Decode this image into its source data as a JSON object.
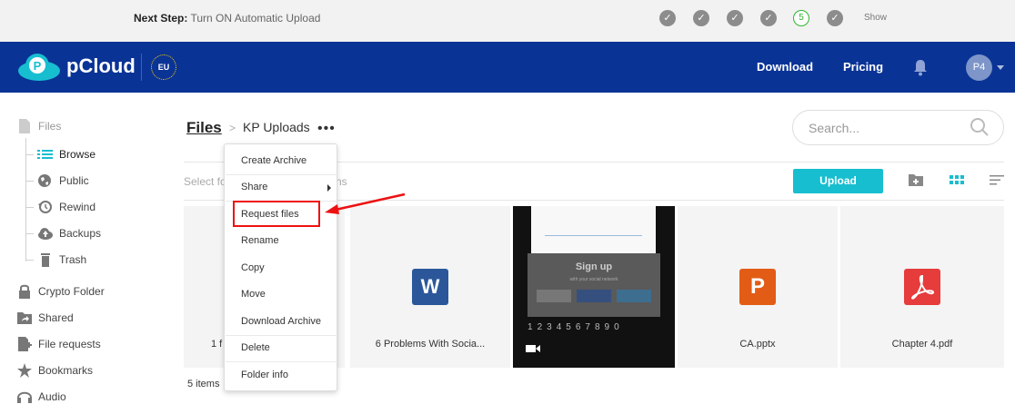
{
  "topbar": {
    "next_step_label": "Next Step:",
    "next_step_text": "Turn ON Automatic Upload",
    "current_step": "5",
    "show_label": "Show"
  },
  "header": {
    "brand": "pCloud",
    "region": "EU",
    "nav_download": "Download",
    "nav_pricing": "Pricing",
    "avatar_initials": "P4"
  },
  "sidebar": {
    "files": "Files",
    "browse": "Browse",
    "public": "Public",
    "rewind": "Rewind",
    "backups": "Backups",
    "trash": "Trash",
    "crypto": "Crypto Folder",
    "shared": "Shared",
    "file_requests": "File requests",
    "bookmarks": "Bookmarks",
    "audio": "Audio"
  },
  "breadcrumb": {
    "root": "Files",
    "separator": ">",
    "current": "KP Uploads",
    "more": "•••"
  },
  "search": {
    "placeholder": "Search..."
  },
  "toolbar": {
    "select_prefix": "Select fo",
    "select_suffix": "ns",
    "upload_label": "Upload"
  },
  "files": [
    {
      "name": "1 f",
      "type": "folder"
    },
    {
      "name": "6 Problems With Socia...",
      "type": "docx",
      "icon_letter": "W",
      "icon_color": "#2b579a"
    },
    {
      "name": "",
      "type": "video"
    },
    {
      "name": "CA.pptx",
      "type": "pptx",
      "icon_letter": "P",
      "icon_color": "#e35c16"
    },
    {
      "name": "Chapter 4.pdf",
      "type": "pdf",
      "icon_color": "#e63c3c"
    }
  ],
  "video_thumb": {
    "title": "Sign up",
    "subtitle": "with your social network",
    "key_row": [
      "1",
      "2",
      "3",
      "4",
      "5",
      "6",
      "7",
      "8",
      "9",
      "0"
    ]
  },
  "item_count": "5 items",
  "context_menu": [
    "Create Archive",
    "Share",
    "Request files",
    "Rename",
    "Copy",
    "Move",
    "Download Archive",
    "Delete",
    "Folder info"
  ],
  "colors": {
    "header_bg": "#0a3396",
    "accent": "#17bed0",
    "highlight": "#ee1111"
  }
}
